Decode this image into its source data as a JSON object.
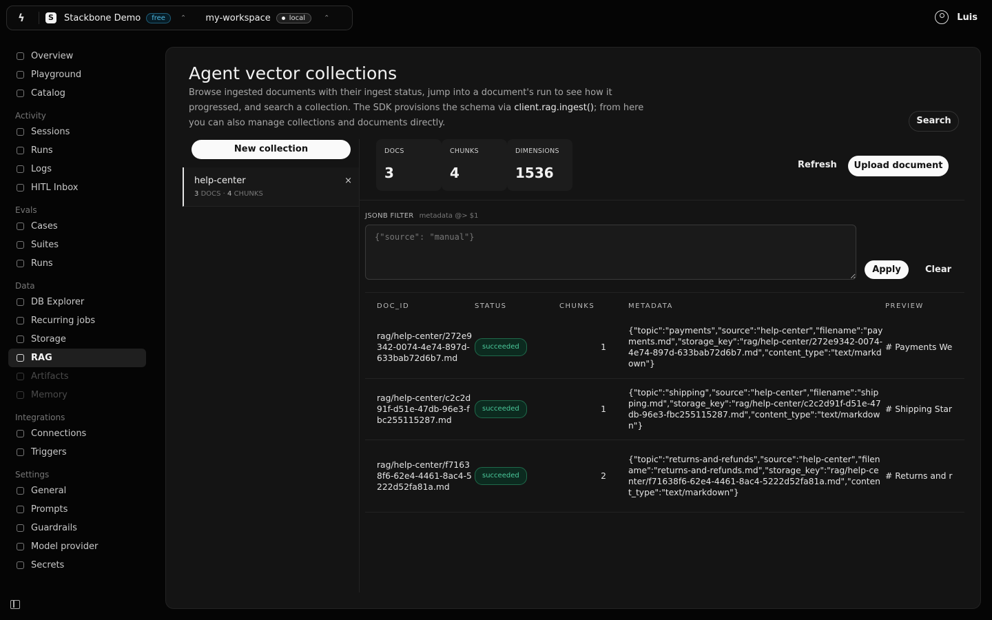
{
  "topbar": {
    "org_initial": "S",
    "org_name": "Stackbone Demo",
    "plan": "free",
    "workspace": "my-workspace",
    "environment": "local",
    "user_name": "Luis"
  },
  "sidebar": {
    "top_items": [
      {
        "label": "Overview",
        "icon": "info-icon"
      },
      {
        "label": "Playground",
        "icon": "play-icon"
      },
      {
        "label": "Catalog",
        "icon": "catalog-icon"
      }
    ],
    "sections": [
      {
        "title": "Activity",
        "items": [
          {
            "label": "Sessions",
            "icon": "list-icon"
          },
          {
            "label": "Runs",
            "icon": "runs-icon"
          },
          {
            "label": "Logs",
            "icon": "logs-icon"
          },
          {
            "label": "HITL Inbox",
            "icon": "inbox-icon"
          }
        ]
      },
      {
        "title": "Evals",
        "items": [
          {
            "label": "Cases",
            "icon": "cases-icon"
          },
          {
            "label": "Suites",
            "icon": "suites-icon"
          },
          {
            "label": "Runs",
            "icon": "chart-icon"
          }
        ]
      },
      {
        "title": "Data",
        "items": [
          {
            "label": "DB Explorer",
            "icon": "database-icon"
          },
          {
            "label": "Recurring jobs",
            "icon": "clock-icon"
          },
          {
            "label": "Storage",
            "icon": "storage-icon"
          },
          {
            "label": "RAG",
            "icon": "rag-icon",
            "active": true
          },
          {
            "label": "Artifacts",
            "icon": "artifacts-icon",
            "disabled": true
          },
          {
            "label": "Memory",
            "icon": "memory-icon",
            "disabled": true
          }
        ]
      },
      {
        "title": "Integrations",
        "items": [
          {
            "label": "Connections",
            "icon": "link-icon"
          },
          {
            "label": "Triggers",
            "icon": "trigger-icon"
          }
        ]
      },
      {
        "title": "Settings",
        "items": [
          {
            "label": "General",
            "icon": "globe-icon"
          },
          {
            "label": "Prompts",
            "icon": "prompt-icon"
          },
          {
            "label": "Guardrails",
            "icon": "shield-icon"
          },
          {
            "label": "Model provider",
            "icon": "model-icon"
          },
          {
            "label": "Secrets",
            "icon": "key-icon"
          }
        ]
      }
    ]
  },
  "page": {
    "title": "Agent vector collections",
    "description_before": "Browse ingested documents with their ingest status, jump into a document's run to see how it progressed, and search a collection. The SDK provisions the schema via ",
    "description_code": "client.rag.ingest()",
    "description_after": "; from here you can also manage collections and documents directly.",
    "search_label": "Search"
  },
  "collections": {
    "new_label": "New collection",
    "items": [
      {
        "name": "help-center",
        "docs": "3",
        "docs_label": "DOCS",
        "chunks": "4",
        "chunks_label": "CHUNKS"
      }
    ]
  },
  "stats": [
    {
      "label": "DOCS",
      "value": "3"
    },
    {
      "label": "CHUNKS",
      "value": "4"
    },
    {
      "label": "DIMENSIONS",
      "value": "1536"
    }
  ],
  "actions": {
    "refresh": "Refresh",
    "upload": "Upload document"
  },
  "filter": {
    "label": "JSONB FILTER",
    "hint": "metadata @> $1",
    "placeholder": "{\"source\": \"manual\"}",
    "value": "",
    "apply": "Apply",
    "clear": "Clear"
  },
  "table": {
    "headers": {
      "doc_id": "DOC_ID",
      "status": "STATUS",
      "chunks": "CHUNKS",
      "metadata": "METADATA",
      "preview": "PREVIEW"
    },
    "rows": [
      {
        "doc_id": "rag/help-center/272e9342-0074-4e74-897d-633bab72d6b7.md",
        "status": "succeeded",
        "chunks": "1",
        "metadata": "{\"topic\":\"payments\",\"source\":\"help-center\",\"filename\":\"payments.md\",\"storage_key\":\"rag/help-center/272e9342-0074-4e74-897d-633bab72d6b7.md\",\"content_type\":\"text/markdown\"}",
        "preview": "# Payments We"
      },
      {
        "doc_id": "rag/help-center/c2c2d91f-d51e-47db-96e3-fbc255115287.md",
        "status": "succeeded",
        "chunks": "1",
        "metadata": "{\"topic\":\"shipping\",\"source\":\"help-center\",\"filename\":\"shipping.md\",\"storage_key\":\"rag/help-center/c2c2d91f-d51e-47db-96e3-fbc255115287.md\",\"content_type\":\"text/markdown\"}",
        "preview": "# Shipping Star"
      },
      {
        "doc_id": "rag/help-center/f71638f6-62e4-4461-8ac4-5222d52fa81a.md",
        "status": "succeeded",
        "chunks": "2",
        "metadata": "{\"topic\":\"returns-and-refunds\",\"source\":\"help-center\",\"filename\":\"returns-and-refunds.md\",\"storage_key\":\"rag/help-center/f71638f6-62e4-4461-8ac4-5222d52fa81a.md\",\"content_type\":\"text/markdown\"}",
        "preview": "# Returns and r"
      }
    ]
  }
}
